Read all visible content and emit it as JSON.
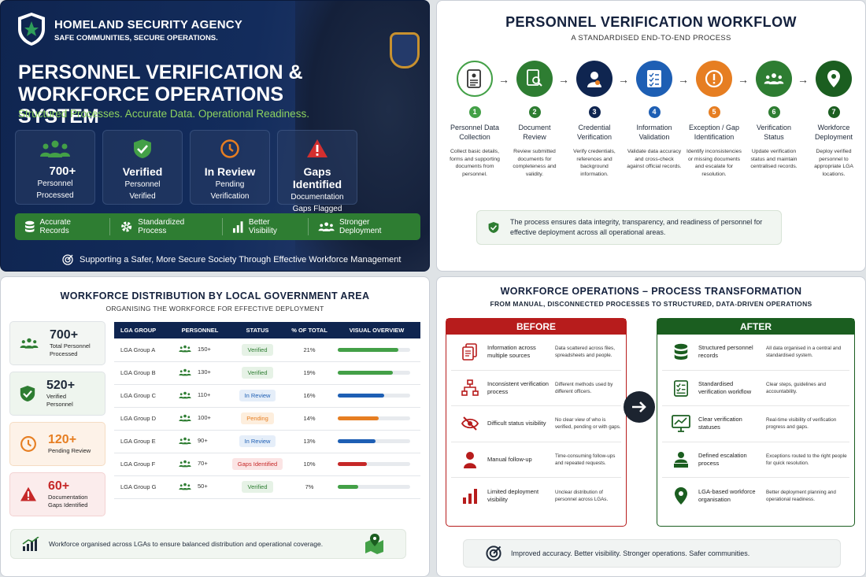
{
  "hero": {
    "org_name": "HOMELAND SECURITY AGENCY",
    "org_tagline": "SAFE COMMUNITIES, SECURE OPERATIONS.",
    "title_line1": "PERSONNEL VERIFICATION &",
    "title_line2": "WORKFORCE OPERATIONS SYSTEM",
    "tagline": "Structured Processes. Accurate Data. Operational Readiness.",
    "stats": [
      {
        "value": "700+",
        "line1": "Personnel",
        "line2": "Processed",
        "icon": "people-icon"
      },
      {
        "value": "Verified",
        "line1": "Personnel",
        "line2": "Verified",
        "icon": "shield-check-icon"
      },
      {
        "value": "In Review",
        "line1": "Pending",
        "line2": "Verification",
        "icon": "clock-icon"
      },
      {
        "value": "Gaps Identified",
        "line1": "Documentation",
        "line2": "Gaps Flagged",
        "icon": "warning-icon"
      }
    ],
    "benefits": [
      "Accurate Records",
      "Standardized Process",
      "Better Visibility",
      "Stronger Deployment"
    ],
    "footer": "Supporting a Safer, More Secure Society Through Effective Workforce Management",
    "colors": {
      "navy": "#0f2550",
      "green": "#2e7d32",
      "accent_green": "#8dd35f",
      "gold": "#c8912f"
    }
  },
  "workflow": {
    "title": "PERSONNEL VERIFICATION WORKFLOW",
    "subtitle": "A STANDARDISED END-TO-END PROCESS",
    "steps": [
      {
        "num": "1",
        "name": "Personnel Data Collection",
        "desc": "Collect basic details, forms and supporting documents from personnel.",
        "icon": "form-icon",
        "color": "#43a047"
      },
      {
        "num": "2",
        "name": "Document Review",
        "desc": "Review submitted documents for completeness and validity.",
        "icon": "document-search-icon",
        "color": "#2e7d32"
      },
      {
        "num": "3",
        "name": "Credential Verification",
        "desc": "Verify credentials, references and background information.",
        "icon": "user-badge-icon",
        "color": "#0f2550"
      },
      {
        "num": "4",
        "name": "Information Validation",
        "desc": "Validate data accuracy and cross-check against official records.",
        "icon": "checklist-icon",
        "color": "#1e5fb4"
      },
      {
        "num": "5",
        "name": "Exception / Gap Identification",
        "desc": "Identify inconsistencies or missing documents and escalate for resolution.",
        "icon": "alert-icon",
        "color": "#e67e22"
      },
      {
        "num": "6",
        "name": "Verification Status",
        "desc": "Update verification status and maintain centralised records.",
        "icon": "team-icon",
        "color": "#2e7d32"
      },
      {
        "num": "7",
        "name": "Workforce Deployment",
        "desc": "Deploy verified personnel to appropriate LGA locations.",
        "icon": "location-icon",
        "color": "#1b5e20"
      }
    ],
    "note": "The process ensures data integrity, transparency, and readiness of personnel for effective deployment across all operational areas."
  },
  "distribution": {
    "title": "WORKFORCE DISTRIBUTION BY LOCAL GOVERNMENT AREA",
    "subtitle": "ORGANISING THE WORKFORCE FOR EFFECTIVE DEPLOYMENT",
    "cards": [
      {
        "value": "700+",
        "line1": "Total Personnel",
        "line2": "Processed",
        "icon": "people-icon",
        "color": "#2e7d32",
        "bg": "#f3f6f3"
      },
      {
        "value": "520+",
        "line1": "Verified",
        "line2": "Personnel",
        "icon": "shield-check-icon",
        "color": "#2e7d32",
        "bg": "#eef5ee"
      },
      {
        "value": "120+",
        "line1": "Pending Review",
        "line2": "",
        "icon": "clock-icon",
        "color": "#e67e22",
        "bg": "#fdf2e8"
      },
      {
        "value": "60+",
        "line1": "Documentation",
        "line2": "Gaps Identified",
        "icon": "warning-icon",
        "color": "#c62828",
        "bg": "#fbecec"
      }
    ],
    "columns": [
      "LGA GROUP",
      "PERSONNEL",
      "STATUS",
      "% OF TOTAL",
      "VISUAL OVERVIEW"
    ],
    "rows": [
      {
        "group": "LGA Group A",
        "personnel": "150+",
        "status": "Verified",
        "pct": "21%",
        "fill": 0.21,
        "status_color": "#2e7d32",
        "status_bg": "#e6f2e6",
        "bar": "#43a047"
      },
      {
        "group": "LGA Group B",
        "personnel": "130+",
        "status": "Verified",
        "pct": "19%",
        "fill": 0.19,
        "status_color": "#2e7d32",
        "status_bg": "#e6f2e6",
        "bar": "#43a047"
      },
      {
        "group": "LGA Group C",
        "personnel": "110+",
        "status": "In Review",
        "pct": "16%",
        "fill": 0.16,
        "status_color": "#1e5fb4",
        "status_bg": "#e5eef9",
        "bar": "#1e5fb4"
      },
      {
        "group": "LGA Group D",
        "personnel": "100+",
        "status": "Pending",
        "pct": "14%",
        "fill": 0.14,
        "status_color": "#e67e22",
        "status_bg": "#fdeedd",
        "bar": "#e67e22"
      },
      {
        "group": "LGA Group E",
        "personnel": "90+",
        "status": "In Review",
        "pct": "13%",
        "fill": 0.13,
        "status_color": "#1e5fb4",
        "status_bg": "#e5eef9",
        "bar": "#1e5fb4"
      },
      {
        "group": "LGA Group F",
        "personnel": "70+",
        "status": "Gaps Identified",
        "pct": "10%",
        "fill": 0.1,
        "status_color": "#c62828",
        "status_bg": "#fbe4e4",
        "bar": "#c62828"
      },
      {
        "group": "LGA Group G",
        "personnel": "50+",
        "status": "Verified",
        "pct": "7%",
        "fill": 0.07,
        "status_color": "#2e7d32",
        "status_bg": "#e6f2e6",
        "bar": "#43a047"
      }
    ],
    "note": "Workforce organised across LGAs to ensure balanced distribution and operational coverage."
  },
  "transformation": {
    "title": "WORKFORCE OPERATIONS – PROCESS TRANSFORMATION",
    "subtitle": "FROM MANUAL, DISCONNECTED PROCESSES TO STRUCTURED, DATA-DRIVEN OPERATIONS",
    "before_label": "BEFORE",
    "after_label": "AFTER",
    "before": [
      {
        "title": "Information across multiple sources",
        "desc": "Data scattered across files, spreadsheets and people.",
        "icon": "files-icon"
      },
      {
        "title": "Inconsistent verification process",
        "desc": "Different methods used by different officers.",
        "icon": "network-icon"
      },
      {
        "title": "Difficult status visibility",
        "desc": "No clear view of who is verified, pending or with gaps.",
        "icon": "eye-slash-icon"
      },
      {
        "title": "Manual follow-up",
        "desc": "Time-consuming follow-ups and repeated requests.",
        "icon": "person-icon"
      },
      {
        "title": "Limited deployment visibility",
        "desc": "Unclear distribution of personnel across LGAs.",
        "icon": "bar-chart-icon"
      }
    ],
    "after": [
      {
        "title": "Structured personnel records",
        "desc": "All data organised in a central and standardised system.",
        "icon": "database-icon"
      },
      {
        "title": "Standardised verification workflow",
        "desc": "Clear steps, guidelines and accountability.",
        "icon": "checklist-icon"
      },
      {
        "title": "Clear verification statuses",
        "desc": "Real-time visibility of verification progress and gaps.",
        "icon": "monitor-chart-icon"
      },
      {
        "title": "Defined escalation process",
        "desc": "Exceptions routed to the right people for quick resolution.",
        "icon": "escalation-icon"
      },
      {
        "title": "LGA-based workforce organisation",
        "desc": "Better deployment planning and operational readiness.",
        "icon": "location-icon"
      }
    ],
    "note": "Improved accuracy. Better visibility. Stronger operations. Safer communities.",
    "colors": {
      "before": "#b71c1c",
      "after": "#1b5e20"
    }
  }
}
